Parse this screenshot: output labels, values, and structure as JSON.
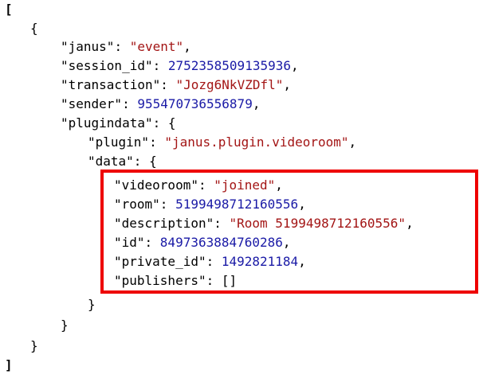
{
  "json_view": {
    "open_array": "[",
    "open_obj": "{",
    "janus_key": "\"janus\"",
    "janus_val": "\"event\"",
    "session_key": "\"session_id\"",
    "session_val": "2752358509135936",
    "transaction_key": "\"transaction\"",
    "transaction_val": "\"Jozg6NkVZDfl\"",
    "sender_key": "\"sender\"",
    "sender_val": "955470736556879",
    "plugindata_key": "\"plugindata\"",
    "plugin_key": "\"plugin\"",
    "plugin_val": "\"janus.plugin.videoroom\"",
    "data_key": "\"data\"",
    "videoroom_key": "\"videoroom\"",
    "videoroom_val": "\"joined\"",
    "room_key": "\"room\"",
    "room_val": "5199498712160556",
    "description_key": "\"description\"",
    "description_val": "\"Room 5199498712160556\"",
    "id_key": "\"id\"",
    "id_val": "8497363884760286",
    "private_id_key": "\"private_id\"",
    "private_id_val": "1492821184",
    "publishers_key": "\"publishers\"",
    "publishers_val": "[]",
    "close_obj": "}",
    "close_array": "]"
  },
  "colors": {
    "string": "#a31515",
    "number": "#1a1aa6",
    "highlight_border": "#ee0000"
  }
}
